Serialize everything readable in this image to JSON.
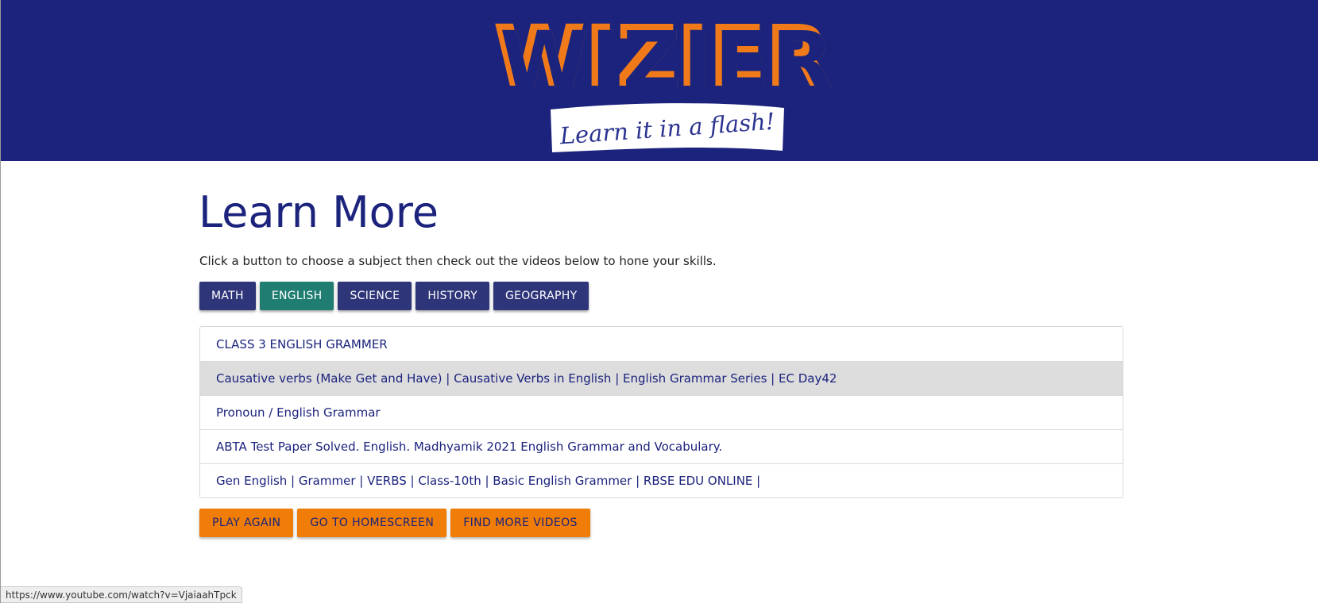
{
  "brand": {
    "name": "WIZIER",
    "tagline": "Learn it in a flash!",
    "colors": {
      "header_bg": "#1b237d",
      "logo_orange": "#f07a1a",
      "active_tab": "#1f7d72",
      "tab": "#2e3579",
      "action": "#ef7d07"
    }
  },
  "page": {
    "title": "Learn More",
    "instructions": "Click a button to choose a subject then check out the videos below to hone your skills."
  },
  "subjects": [
    {
      "label": "MATH",
      "active": false
    },
    {
      "label": "ENGLISH",
      "active": true
    },
    {
      "label": "SCIENCE",
      "active": false
    },
    {
      "label": "HISTORY",
      "active": false
    },
    {
      "label": "GEOGRAPHY",
      "active": false
    }
  ],
  "videos": [
    {
      "title": "CLASS 3 ENGLISH GRAMMER"
    },
    {
      "title": "Causative verbs (Make Get and Have) | Causative Verbs in English | English Grammar Series | EC Day42",
      "hovered": true
    },
    {
      "title": "Pronoun / English Grammar"
    },
    {
      "title": "ABTA Test Paper Solved. English. Madhyamik 2021 English Grammar and Vocabulary."
    },
    {
      "title": "Gen English | Grammer | VERBS | Class-10th | Basic English Grammer | RBSE EDU ONLINE |"
    }
  ],
  "actions": {
    "play_again": "PLAY AGAIN",
    "homescreen": "GO TO HOMESCREEN",
    "find_more": "FIND MORE VIDEOS"
  },
  "status_bar": {
    "url": "https://www.youtube.com/watch?v=VjaiaahTpck"
  }
}
